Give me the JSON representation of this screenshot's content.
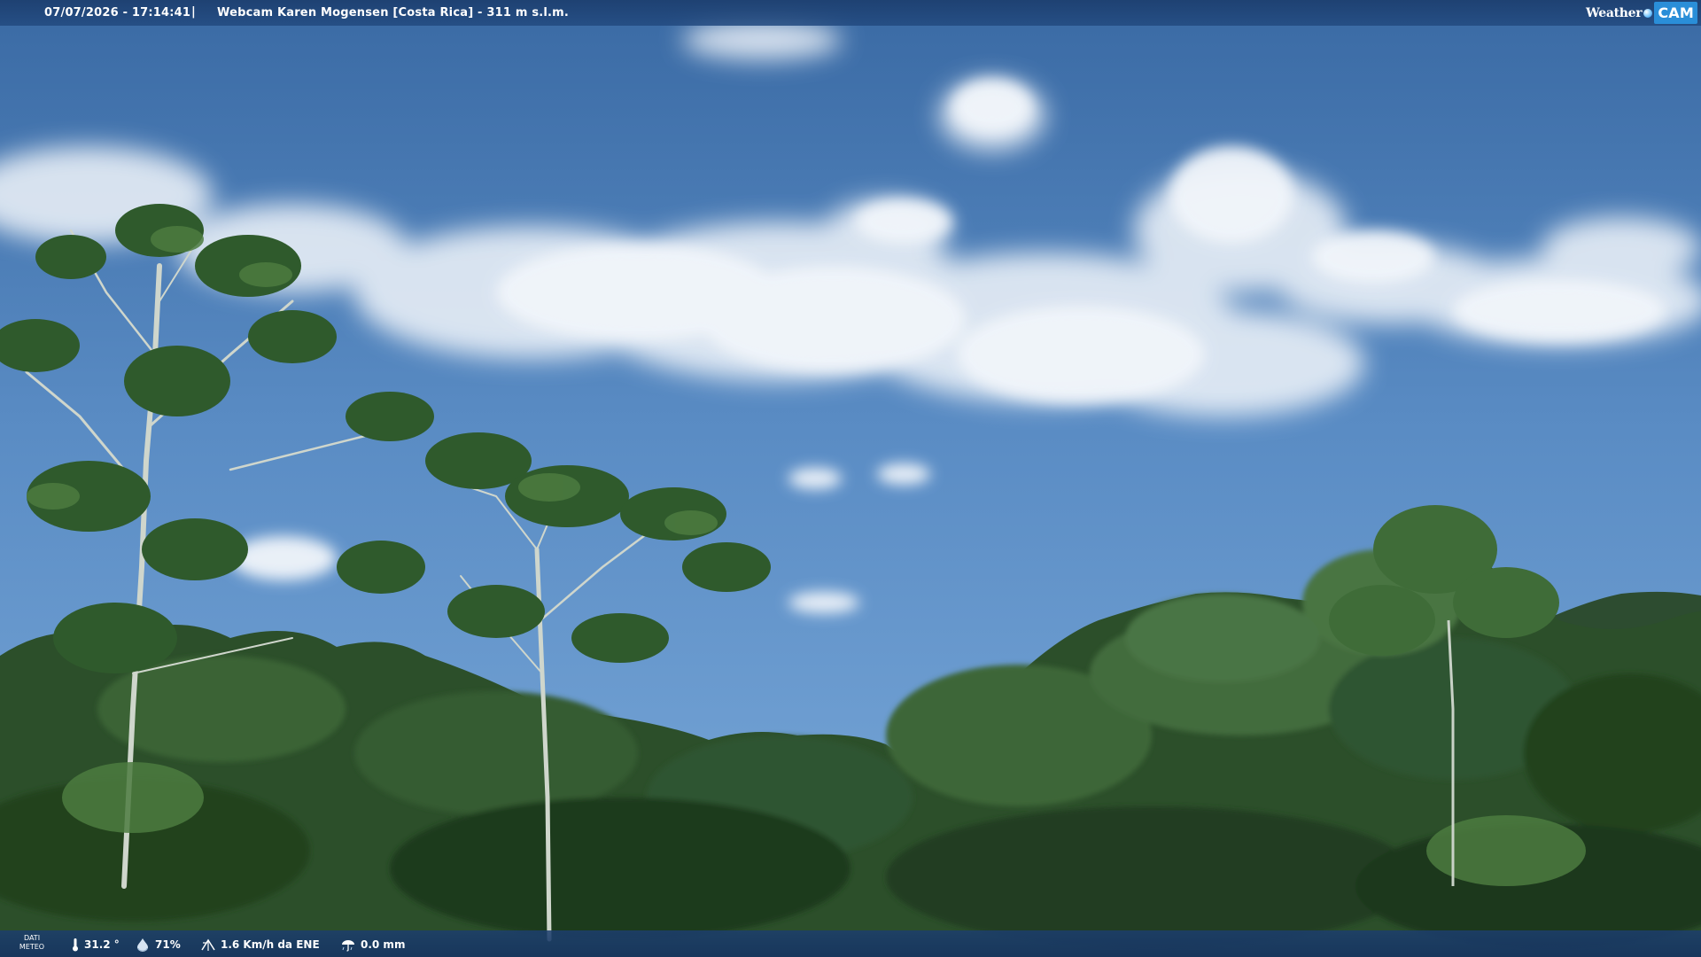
{
  "header": {
    "timestamp": "07/07/2026 - 17:14:41",
    "divider": "|",
    "title": "Webcam Karen Mogensen [Costa Rica]  - 311 m s.l.m.",
    "brand_weather": "Weather",
    "brand_cam": "CAM"
  },
  "footer": {
    "meteo_label_line1": "DATI",
    "meteo_label_line2": "METEO",
    "temperature": "31.2 °",
    "humidity": "71%",
    "wind": "1.6 Km/h da ENE",
    "rain": "0.0 mm"
  },
  "icons": {
    "temperature": "thermometer-icon",
    "humidity": "humidity-drop-icon",
    "wind": "wind-icon",
    "rain": "rain-gauge-icon",
    "brand": "globe-icon"
  },
  "colors": {
    "sky_top": "#3e6fa8",
    "sky_bottom": "#6f9fd0",
    "bar": "#1f467c",
    "foliage_dark": "#1f3a1f",
    "foliage_mid": "#2f5a2c",
    "foliage_light": "#4d7a3e",
    "brand_accent": "#2a8ed8"
  }
}
